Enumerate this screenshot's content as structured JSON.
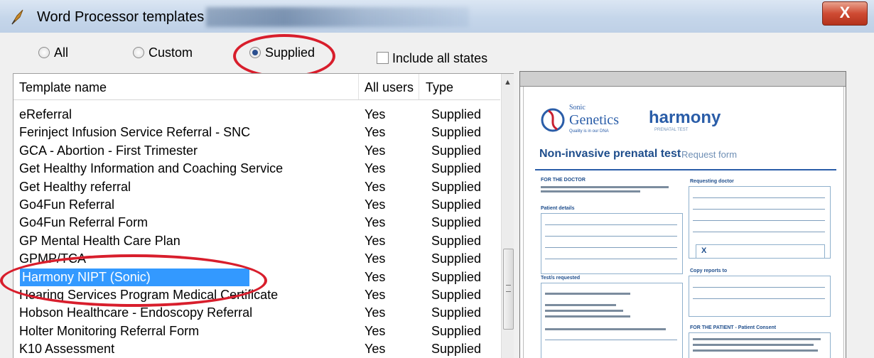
{
  "window": {
    "title": "Word Processor templates",
    "close_label": "X"
  },
  "filters": {
    "all_label": "All",
    "custom_label": "Custom",
    "supplied_label": "Supplied",
    "selected": "Supplied",
    "include_all_states_label": "Include all states",
    "include_all_states_checked": false
  },
  "table": {
    "columns": [
      "Template name",
      "All users",
      "Type"
    ],
    "rows": [
      {
        "name": "eReferral",
        "all_users": "Yes",
        "type": "Supplied"
      },
      {
        "name": "Ferinject Infusion Service Referral - SNC",
        "all_users": "Yes",
        "type": "Supplied"
      },
      {
        "name": "GCA - Abortion - First Trimester",
        "all_users": "Yes",
        "type": "Supplied"
      },
      {
        "name": "Get Healthy Information and Coaching Service",
        "all_users": "Yes",
        "type": "Supplied"
      },
      {
        "name": "Get Healthy referral",
        "all_users": "Yes",
        "type": "Supplied"
      },
      {
        "name": "Go4Fun Referral",
        "all_users": "Yes",
        "type": "Supplied"
      },
      {
        "name": "Go4Fun Referral Form",
        "all_users": "Yes",
        "type": "Supplied"
      },
      {
        "name": "GP Mental Health Care Plan",
        "all_users": "Yes",
        "type": "Supplied"
      },
      {
        "name": "GPMP/TCA",
        "all_users": "Yes",
        "type": "Supplied"
      },
      {
        "name": "Harmony NIPT (Sonic)",
        "all_users": "Yes",
        "type": "Supplied"
      },
      {
        "name": "Hearing Services Program Medical Certificate",
        "all_users": "Yes",
        "type": "Supplied"
      },
      {
        "name": "Hobson Healthcare - Endoscopy Referral",
        "all_users": "Yes",
        "type": "Supplied"
      },
      {
        "name": "Holter Monitoring Referral Form",
        "all_users": "Yes",
        "type": "Supplied"
      },
      {
        "name": "K10 Assessment",
        "all_users": "Yes",
        "type": "Supplied"
      }
    ],
    "selected_row": "Harmony NIPT (Sonic)"
  },
  "preview": {
    "brand_small": "Sonic",
    "brand_big": "Genetics",
    "brand_tagline": "Quality is in our DNA",
    "product": "harmony",
    "product_sub": "PRENATAL TEST",
    "form_title": "Non-invasive prenatal test",
    "form_subtitle": "Request form",
    "sec_doctor": "FOR THE DOCTOR",
    "sec_requesting": "Requesting doctor",
    "sec_patient": "Patient details",
    "sec_tests": "Test/s requested",
    "sec_copy": "Copy reports to",
    "sec_consent": "FOR THE PATIENT - Patient Consent",
    "mark_x": "X",
    "colors": {
      "accent": "#2a5da8",
      "title_blue": "#1f4e8c",
      "selection": "#3399ff",
      "annotation": "#d81e2c"
    }
  }
}
